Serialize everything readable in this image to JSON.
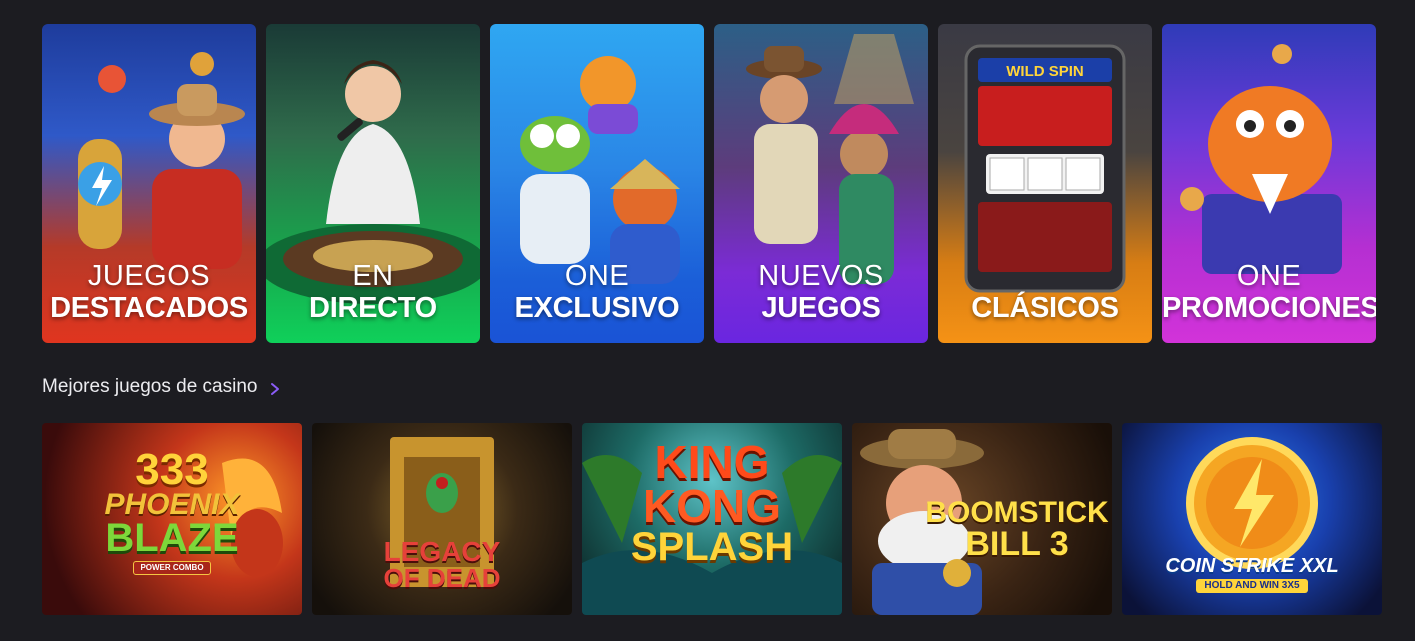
{
  "categories": [
    {
      "line1": "JUEGOS",
      "line2": "DESTACADOS"
    },
    {
      "line1": "EN",
      "line2": "DIRECTO"
    },
    {
      "line1": "ONE",
      "line2": "EXCLUSIVO"
    },
    {
      "line1": "NUEVOS",
      "line2": "JUEGOS"
    },
    {
      "line1": "",
      "line2": "CLÁSICOS"
    },
    {
      "line1": "ONE",
      "line2": "PROMOCIONES"
    }
  ],
  "section": {
    "title": "Mejores juegos de casino"
  },
  "games": [
    {
      "logo_top": "333",
      "logo_mid": "PHOENIX",
      "logo_bottom": "BLAZE",
      "badge": "POWER COMBO"
    },
    {
      "logo_top": "LEGACY",
      "logo_bottom": "OF DEAD"
    },
    {
      "logo_top": "KING",
      "logo_mid": "KONG",
      "logo_bottom": "SPLASH"
    },
    {
      "logo_top": "BOOMSTICK",
      "logo_bottom": "BILL 3"
    },
    {
      "logo_top": "COIN STRIKE XXL",
      "logo_bottom": "HOLD AND WIN 3X5"
    }
  ],
  "colors": {
    "background": "#1c1c21",
    "chevron": "#8a5cf6"
  }
}
